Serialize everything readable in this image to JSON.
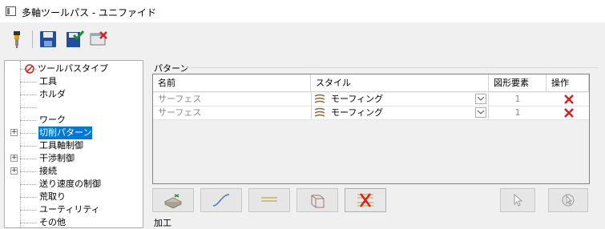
{
  "window": {
    "title": "多軸ツールパス - ユニファイド"
  },
  "toolbar": {
    "icons": [
      "tool-icon",
      "save-icon",
      "save-close-icon",
      "cancel-icon"
    ]
  },
  "tree": {
    "items": [
      {
        "label": "ツールパスタイプ",
        "icon": "error-icon"
      },
      {
        "label": "工具"
      },
      {
        "label": "ホルダ"
      },
      {
        "label": ""
      },
      {
        "label": "ワーク"
      },
      {
        "label": "切削パターン",
        "selected": true,
        "expandable": true
      },
      {
        "label": "工具軸制御"
      },
      {
        "label": "干渉制御",
        "expandable": true
      },
      {
        "label": "接続",
        "expandable": true
      },
      {
        "label": "送り速度の制御"
      },
      {
        "label": "荒取り"
      },
      {
        "label": "ユーティリティ"
      },
      {
        "label": "その他"
      }
    ]
  },
  "pattern": {
    "group_title": "パターン",
    "columns": [
      "名前",
      "スタイル",
      "図形要素",
      "操作"
    ],
    "rows": [
      {
        "name": "サーフェス",
        "style": "モーフィング",
        "count": "1"
      },
      {
        "name": "サーフェス",
        "style": "モーフィング",
        "count": "1"
      }
    ]
  },
  "buttons": [
    "add-surface-icon",
    "add-curve-icon",
    "add-lines-icon",
    "add-box-icon",
    "delete-all-icon",
    "select-icon",
    "pick-icon"
  ],
  "bottom": {
    "label": "加工"
  },
  "colors": {
    "selection": "#0078d7",
    "delete": "#d9201f"
  }
}
